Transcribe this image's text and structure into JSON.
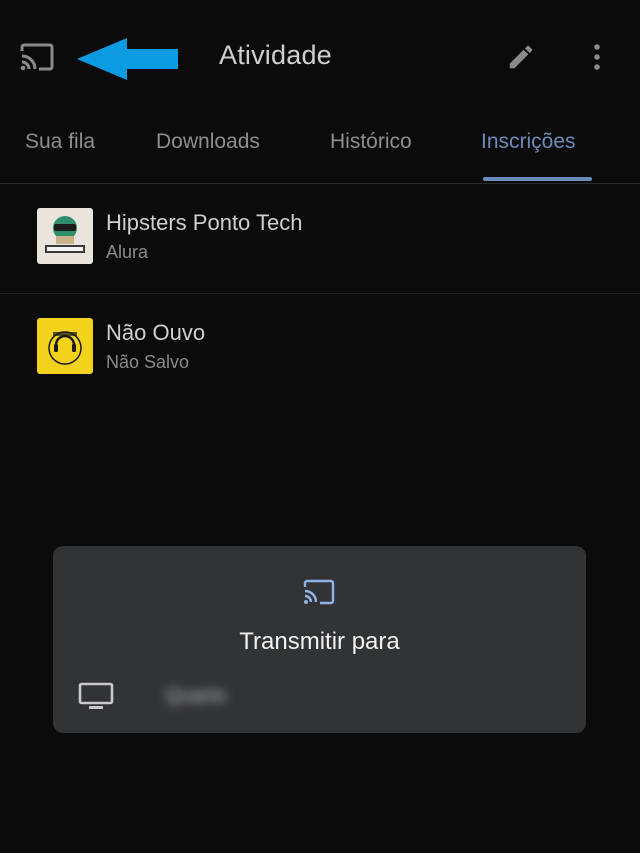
{
  "appbar": {
    "title": "Atividade",
    "icons": {
      "cast": "cast-icon",
      "edit": "pencil-icon",
      "more": "more-vert-icon",
      "annotation": "arrow-left-icon"
    },
    "annotation_color": "#0a9be0"
  },
  "tabs": [
    {
      "label": "Sua fila",
      "active": false
    },
    {
      "label": "Downloads",
      "active": false
    },
    {
      "label": "Histórico",
      "active": false
    },
    {
      "label": "Inscrições",
      "active": true
    }
  ],
  "colors": {
    "accent": "#6d8bb8",
    "background": "#0b0b0c",
    "dialog": "#323335"
  },
  "subscriptions": [
    {
      "title": "Hipsters Ponto Tech",
      "subtitle": "Alura",
      "thumb_icon": "hipsters-podcast-thumbnail"
    },
    {
      "title": "Não Ouvo",
      "subtitle": "Não Salvo",
      "thumb_icon": "nao-ouvo-podcast-thumbnail"
    }
  ],
  "cast_dialog": {
    "title": "Transmitir para",
    "icon": "cast-icon",
    "devices": [
      {
        "name": "Quarto",
        "icon": "tv-icon"
      }
    ]
  }
}
